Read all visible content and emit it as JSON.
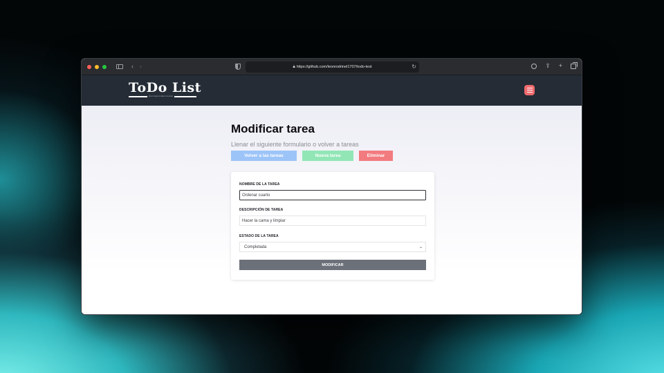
{
  "browser": {
    "url": "https://github.com/leonrodrinel1707/todo-test",
    "lock_icon": "lock-icon",
    "reload_icon": "reload-icon"
  },
  "app": {
    "logo_title": "ToDo List",
    "logo_subtitle": "lorem ipsum dolor sit amet",
    "menu_icon": "hamburger-menu-icon",
    "menu_color": "#f06a6e",
    "header_color": "#252c36"
  },
  "page": {
    "title": "Modificar tarea",
    "subtitle": "Llenar el siguiente formulario o volver a tareas",
    "buttons": {
      "back": "Volver a las tareas",
      "new": "Nueva tarea",
      "delete": "Eliminar"
    }
  },
  "form": {
    "name_label": "NOMBRE DE LA TAREA",
    "name_value": "Ordenar cuarto",
    "description_label": "DESCRIPCIÓN DE TAREA",
    "description_value": "Hacer la cama y limpiar",
    "status_label": "ESTADO DE LA TAREA",
    "status_value": "Completada",
    "submit_label": "MODIFICAR"
  }
}
